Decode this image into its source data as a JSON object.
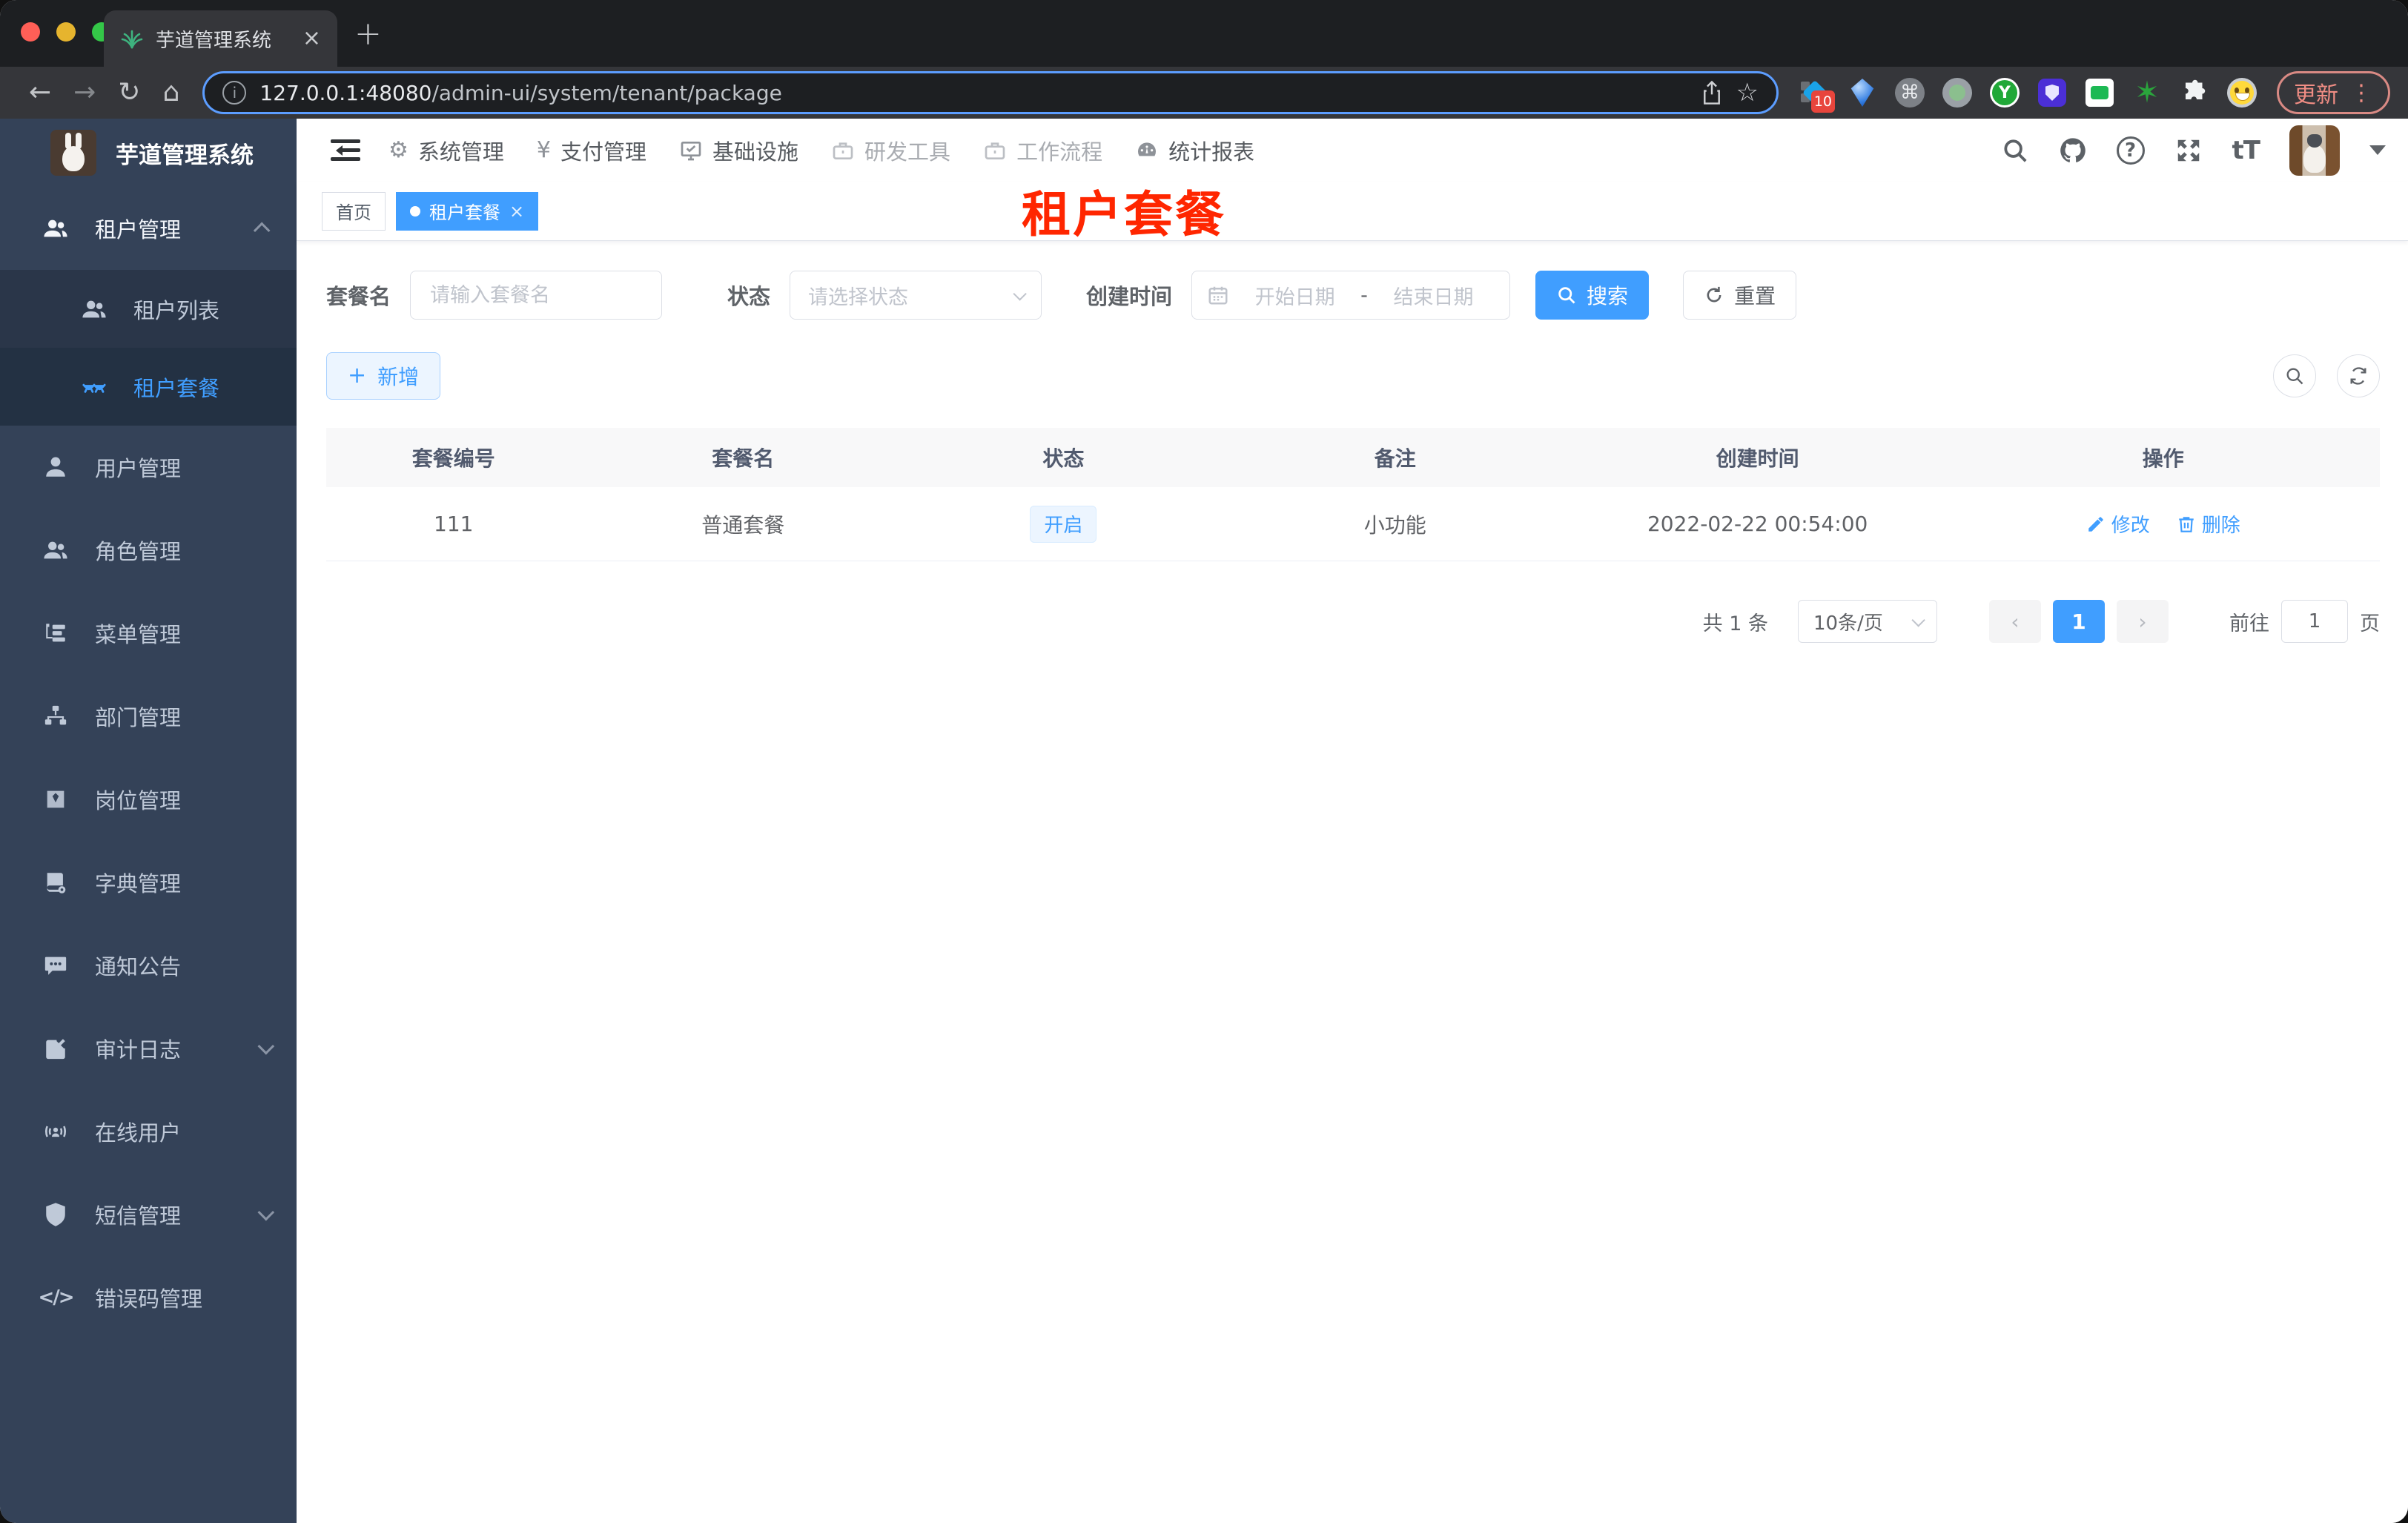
{
  "browser": {
    "tab_title": "芋道管理系统",
    "tab_close": "×",
    "new_tab": "+",
    "back": "←",
    "forward": "→",
    "reload": "↻",
    "home": "⌂",
    "info": "i",
    "url_host": "127.0.0.1:48080",
    "url_path": "/admin-ui/system/tenant/package",
    "star": "☆",
    "ext_badge": "10",
    "cmd_glyph": "⌘",
    "y_glyph": "Y",
    "star_glyph": "✶",
    "update_label": "更新",
    "menu_dots": "⋮"
  },
  "sidebar": {
    "logo_title": "芋道管理系统",
    "group": {
      "label": "租户管理"
    },
    "sub": [
      {
        "label": "租户列表"
      },
      {
        "label": "租户套餐"
      }
    ],
    "items": [
      {
        "label": "用户管理"
      },
      {
        "label": "角色管理"
      },
      {
        "label": "菜单管理"
      },
      {
        "label": "部门管理"
      },
      {
        "label": "岗位管理"
      },
      {
        "label": "字典管理"
      },
      {
        "label": "通知公告"
      },
      {
        "label": "审计日志"
      },
      {
        "label": "在线用户"
      },
      {
        "label": "短信管理"
      },
      {
        "label": "错误码管理"
      }
    ],
    "code_glyph": "</>"
  },
  "topnav": {
    "items": [
      {
        "label": "系统管理"
      },
      {
        "label": "支付管理"
      },
      {
        "label": "基础设施"
      },
      {
        "label": "研发工具"
      },
      {
        "label": "工作流程"
      },
      {
        "label": "统计报表"
      }
    ],
    "gear_glyph": "⚙",
    "yen_glyph": "¥",
    "help_glyph": "?",
    "font_size_glyph": "tT"
  },
  "tags": {
    "home": "首页",
    "active": "租户套餐",
    "close": "×"
  },
  "page": {
    "watermark": "租户套餐"
  },
  "filter": {
    "name_label": "套餐名",
    "name_placeholder": "请输入套餐名",
    "status_label": "状态",
    "status_placeholder": "请选择状态",
    "date_label": "创建时间",
    "date_start": "开始日期",
    "date_sep": "-",
    "date_end": "结束日期",
    "search": "搜索",
    "reset": "重置"
  },
  "toolbar": {
    "add": "新增",
    "plus": "+"
  },
  "table": {
    "headers": [
      "套餐编号",
      "套餐名",
      "状态",
      "备注",
      "创建时间",
      "操作"
    ],
    "rows": [
      {
        "id": "111",
        "name": "普通套餐",
        "status": "开启",
        "remark": "小功能",
        "created": "2022-02-22 00:54:00",
        "edit": "修改",
        "delete": "删除"
      }
    ]
  },
  "pagination": {
    "total": "共 1 条",
    "page_size": "10条/页",
    "prev": "‹",
    "current": "1",
    "next": "›",
    "goto_label": "前往",
    "goto_value": "1",
    "unit": "页"
  },
  "colors": {
    "primary": "#409eff",
    "watermark_red": "#ff2600",
    "sidebar_bg": "#344258"
  }
}
